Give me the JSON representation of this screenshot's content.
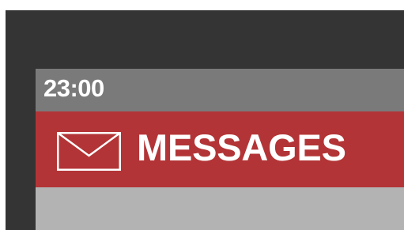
{
  "status_bar": {
    "time": "23:00"
  },
  "header": {
    "title": "MESSAGES",
    "icon": "envelope-icon"
  },
  "colors": {
    "frame": "#343434",
    "status_bar": "#7a7a7a",
    "header": "#b33436",
    "content": "#b3b3b3",
    "text": "#ffffff"
  }
}
